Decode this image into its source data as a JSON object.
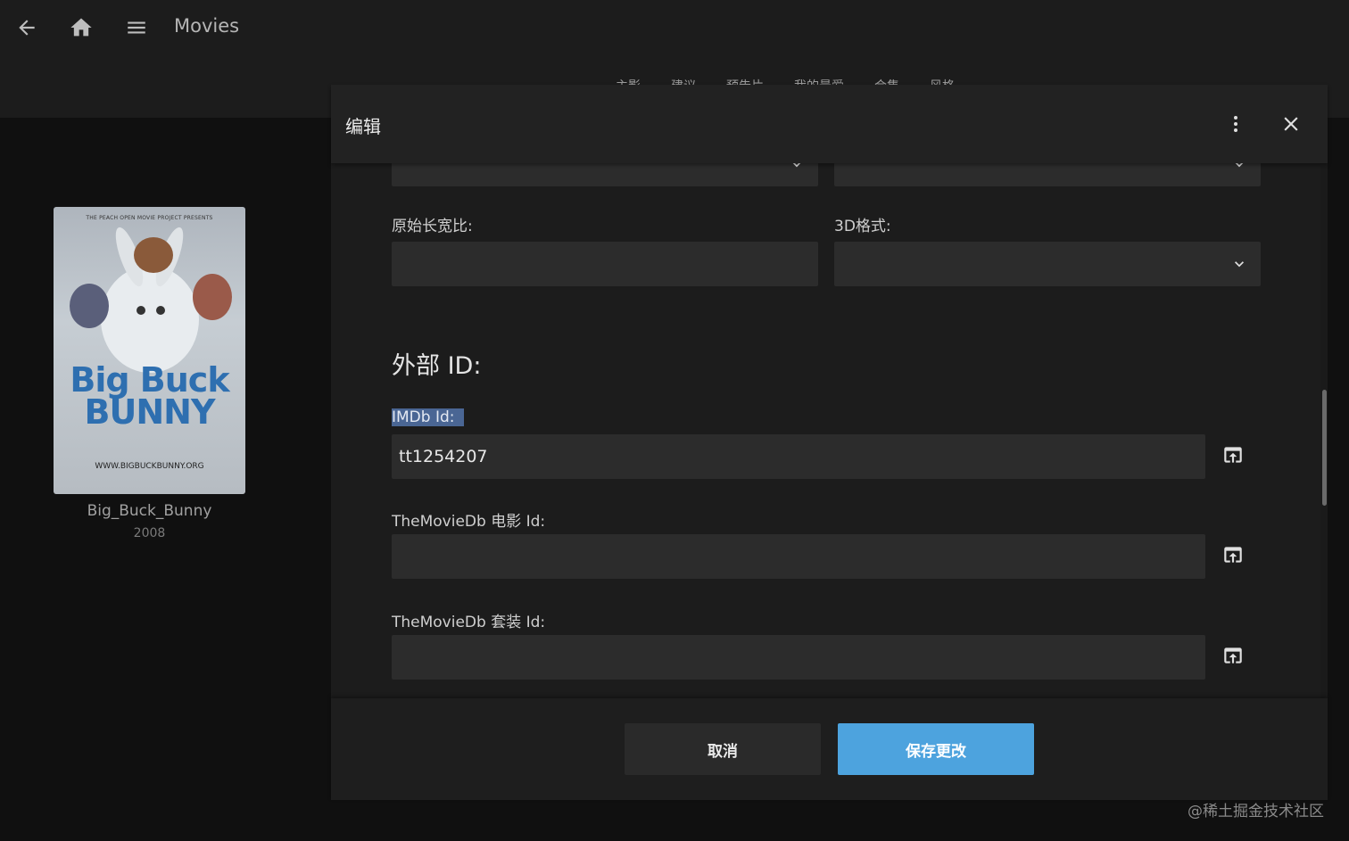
{
  "app": {
    "title": "Movies",
    "tabs": [
      "主影",
      "建议",
      "预告片",
      "我的最爱",
      "合集",
      "风格"
    ]
  },
  "item": {
    "poster_top_text": "THE PEACH OPEN MOVIE PROJECT PRESENTS",
    "poster_title": "Big Buck BUNNY",
    "poster_url": "WWW.BIGBUCKBUNNY.ORG",
    "name": "Big_Buck_Bunny",
    "year": "2008"
  },
  "dialog": {
    "title": "编辑",
    "fields": {
      "aspect_ratio_label": "原始长宽比:",
      "aspect_ratio_value": "",
      "format3d_label": "3D格式:",
      "format3d_value": ""
    },
    "external_ids": {
      "heading": "外部 ID:",
      "imdb_label": "IMDb Id:",
      "imdb_value": "tt1254207",
      "tmdb_movie_label": "TheMovieDb 电影 Id:",
      "tmdb_movie_value": "",
      "tmdb_collection_label": "TheMovieDb 套装 Id:",
      "tmdb_collection_value": ""
    },
    "buttons": {
      "cancel": "取消",
      "save": "保存更改"
    }
  },
  "watermark": "@稀土掘金技术社区",
  "icons": [
    "back-arrow-icon",
    "home-icon",
    "menu-icon",
    "more-vert-icon",
    "close-icon",
    "chevron-down-icon",
    "open-in-new-icon"
  ],
  "colors": {
    "accent": "#4da3de",
    "selection": "#4a6694",
    "background": "#101010",
    "dialog": "#1c1c1c"
  }
}
